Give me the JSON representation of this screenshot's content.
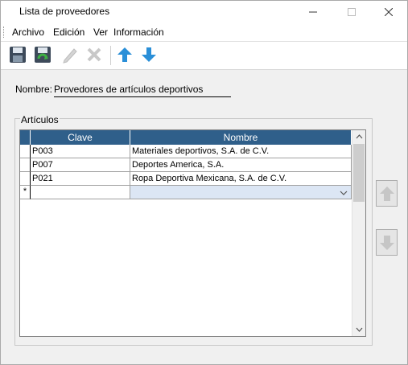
{
  "window": {
    "title": "Lista de proveedores"
  },
  "menu": {
    "items": [
      "Archivo",
      "Edición",
      "Ver",
      "Información"
    ]
  },
  "toolbar": {
    "icons": [
      "save-icon",
      "save-refresh-icon",
      "edit-icon",
      "delete-icon",
      "arrow-up-icon",
      "arrow-down-icon"
    ]
  },
  "form": {
    "nombre_label": "Nombre:",
    "nombre_value": "Provedores de artículos deportivos"
  },
  "articulos": {
    "group_label": "Artículos",
    "columns": [
      "Clave",
      "Nombre"
    ],
    "rows": [
      {
        "clave": "P003",
        "nombre": "Materiales deportivos, S.A. de C.V."
      },
      {
        "clave": "P007",
        "nombre": "Deportes America, S.A."
      },
      {
        "clave": "P021",
        "nombre": "Ropa Deportiva Mexicana, S.A. de C.V."
      }
    ],
    "new_row_marker": "*"
  },
  "colors": {
    "header_bg": "#2f5f8a",
    "selected_cell": "#dce6f4",
    "arrow_blue": "#2a8fd8"
  }
}
